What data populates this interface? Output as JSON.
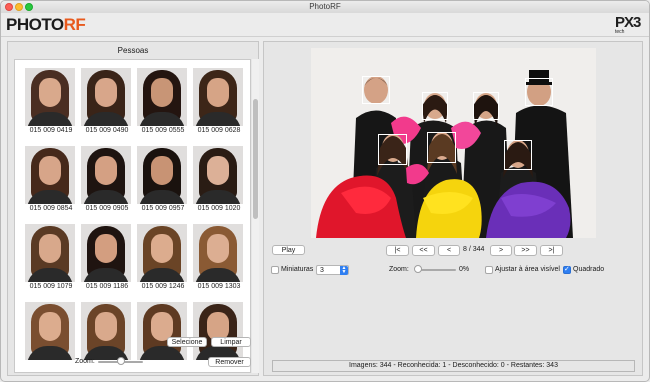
{
  "window": {
    "title": "PhotoRF"
  },
  "brand": {
    "logo_part1": "PHOTO",
    "logo_part2": "RF",
    "px3_text": "PX3",
    "px3_sub": "tech"
  },
  "people_panel": {
    "title": "Pessoas",
    "people": [
      {
        "id": "015 009 0419",
        "hair": "#4a2e22",
        "shirt": "#2a2a2a",
        "skin": "#d9a98c"
      },
      {
        "id": "015 009 0490",
        "hair": "#3a2418",
        "shirt": "#2a2a2a",
        "skin": "#d8a68a"
      },
      {
        "id": "015 009 0555",
        "hair": "#241510",
        "shirt": "#2a2a2a",
        "skin": "#c89576"
      },
      {
        "id": "015 009 0628",
        "hair": "#3d2618",
        "shirt": "#2a2a2a",
        "skin": "#d6a486"
      },
      {
        "id": "015 009 0854",
        "hair": "#46291b",
        "shirt": "#2a2a2a",
        "skin": "#d7a589"
      },
      {
        "id": "015 009 0905",
        "hair": "#1e1410",
        "shirt": "#2a2a2a",
        "skin": "#d4a083"
      },
      {
        "id": "015 009 0957",
        "hair": "#1a120e",
        "shirt": "#2a2a2a",
        "skin": "#c89374"
      },
      {
        "id": "015 009 1020",
        "hair": "#2a1c14",
        "shirt": "#2a2a2a",
        "skin": "#dcb097"
      },
      {
        "id": "015 009 1079",
        "hair": "#5a3a24",
        "shirt": "#2a2a2a",
        "skin": "#d8a88b"
      },
      {
        "id": "015 009 1186",
        "hair": "#1f1410",
        "shirt": "#2a2a2a",
        "skin": "#d39e80"
      },
      {
        "id": "015 009 1246",
        "hair": "#6a4426",
        "shirt": "#2a2a2a",
        "skin": "#dcac8e"
      },
      {
        "id": "015 009 1303",
        "hair": "#8a5a34",
        "shirt": "#2a2a2a",
        "skin": "#dcae92"
      },
      {
        "id": "",
        "hair": "#7a4e30",
        "shirt": "#2a2a2a",
        "skin": "#dcac8e"
      },
      {
        "id": "",
        "hair": "#6b4428",
        "shirt": "#2a2a2a",
        "skin": "#d9a98c"
      },
      {
        "id": "",
        "hair": "#5e3a22",
        "shirt": "#2a2a2a",
        "skin": "#dbab8e"
      },
      {
        "id": "",
        "hair": "#3a2418",
        "shirt": "#2a2a2a",
        "skin": "#d6a486"
      }
    ],
    "select_button": "Selecione",
    "clear_button": "Limpar",
    "remove_button": "Remover",
    "zoom_label": "Zoom:"
  },
  "viewer": {
    "play_button": "Play",
    "nav": {
      "first": "|<",
      "prev_fast": "<<",
      "prev": "<",
      "next": ">",
      "next_fast": ">>",
      "last": ">|"
    },
    "counter": "8 / 344",
    "thumbnails_label": "Miniaturas",
    "thumbnails_checked": false,
    "thumbnails_value": "3",
    "zoom_label": "Zoom:",
    "zoom_value": "0%",
    "fit_label": "Ajustar à área visível",
    "fit_checked": false,
    "square_label": "Quadrado",
    "square_checked": true,
    "status": "Imagens: 344 - Reconhecida: 1 - Desconhecido: 0 - Restantes: 343"
  },
  "colors": {
    "boa_red": "#e0162b",
    "boa_pink": "#f23a8c",
    "boa_yellow": "#f5d40d",
    "boa_purple": "#6a2fb8",
    "accent": "#2f7ff2"
  }
}
